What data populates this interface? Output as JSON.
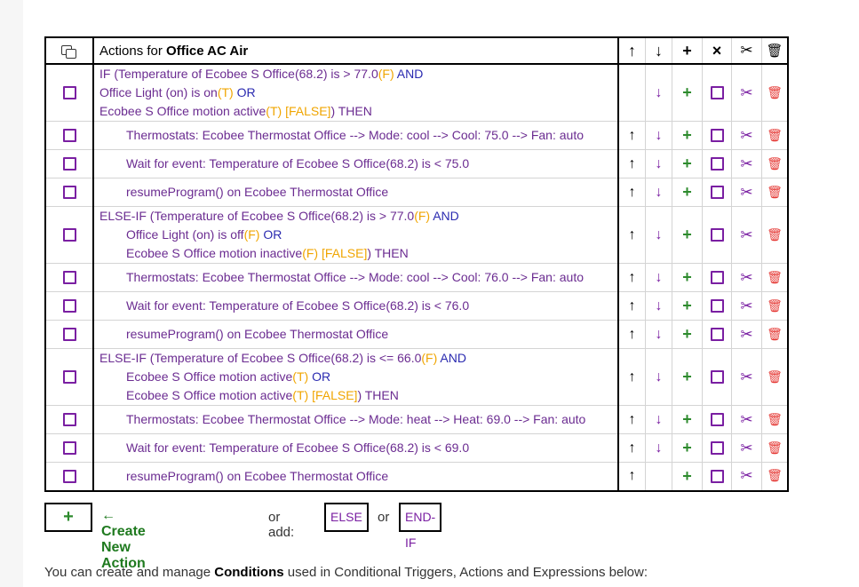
{
  "header": {
    "title_prefix": "Actions for ",
    "title_name": "Office AC Air"
  },
  "icons": {
    "up": "↑",
    "down": "↓",
    "plus": "+",
    "close": "×",
    "cut": "✂",
    "delete": "🗑"
  },
  "rows": [
    {
      "id": "r1"
    },
    {
      "id": "r2"
    },
    {
      "id": "r3"
    },
    {
      "id": "r4"
    },
    {
      "id": "r5"
    },
    {
      "id": "r6"
    },
    {
      "id": "r7"
    },
    {
      "id": "r8"
    },
    {
      "id": "r9"
    },
    {
      "id": "r10"
    },
    {
      "id": "r11"
    },
    {
      "id": "r12"
    }
  ],
  "blocks": {
    "if1": {
      "l1a": "IF (Temperature of Ecobee S Office(68.2) is > 77.0",
      "l1tf": "(F)",
      "l1kw": "AND",
      "l2a": "Office Light (on) is on",
      "l2tf": "(T)",
      "l2kw": "OR",
      "l3a": "Ecobee S Office motion active",
      "l3tf": "(T)",
      "l3tf2": "[FALSE]",
      "l3b": ") THEN"
    },
    "a1": "Thermostats: Ecobee Thermostat Office  --> Mode: cool --> Cool: 75.0 --> Fan: auto",
    "a2": "Wait for event: Temperature of Ecobee S Office(68.2) is < 75.0",
    "a3": "resumeProgram() on Ecobee Thermostat Office",
    "elif1": {
      "l1a": "ELSE-IF (Temperature of Ecobee S Office(68.2) is > 77.0",
      "l1tf": "(F)",
      "l1kw": "AND",
      "l2a": "Office Light (on) is off",
      "l2tf": "(F)",
      "l2kw": "OR",
      "l3a": "Ecobee S Office motion inactive",
      "l3tf": "(F)",
      "l3tf2": "[FALSE]",
      "l3b": ") THEN"
    },
    "a4": "Thermostats: Ecobee Thermostat Office  --> Mode: cool --> Cool: 76.0 --> Fan: auto",
    "a5": "Wait for event: Temperature of Ecobee S Office(68.2) is < 76.0",
    "a6": "resumeProgram() on Ecobee Thermostat Office",
    "elif2": {
      "l1a": "ELSE-IF (Temperature of Ecobee S Office(68.2) is <= 66.0",
      "l1tf": "(F)",
      "l1kw": "AND",
      "l2a": "Ecobee S Office motion active",
      "l2tf": "(T)",
      "l2kw": "OR",
      "l3a": "Ecobee S Office motion active",
      "l3tf": "(T)",
      "l3tf2": "[FALSE]",
      "l3b": ") THEN"
    },
    "a7": "Thermostats: Ecobee Thermostat Office  --> Mode: heat --> Heat: 69.0 --> Fan: auto",
    "a8": "Wait for event: Temperature of Ecobee S Office(68.2) is < 69.0",
    "a9": "resumeProgram() on Ecobee Thermostat Office"
  },
  "footer": {
    "plus": "+",
    "create": "← Create New Action",
    "or_add": "or add:",
    "else_btn": "ELSE",
    "or": "or",
    "endif_btn": "END-IF"
  },
  "note": {
    "before": "You can create and manage ",
    "bold": "Conditions",
    "after": " used in Conditional Triggers, Actions and Expressions below:"
  },
  "colors": {
    "purple": "#6b2c91",
    "keyword_blue": "#2a2ab0",
    "truth_orange": "#f0a500",
    "green": "#2e8b2e",
    "red": "#e53935"
  }
}
